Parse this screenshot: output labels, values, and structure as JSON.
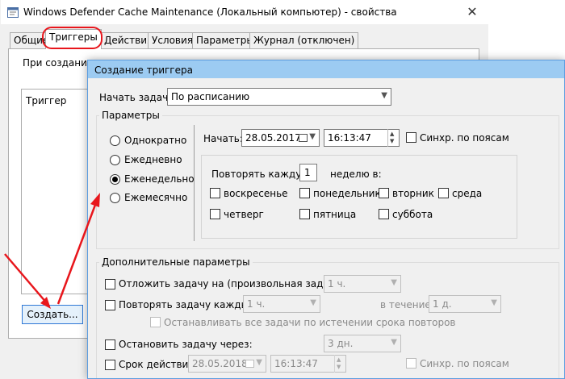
{
  "back_window": {
    "title": "Windows Defender Cache Maintenance (Локальный компьютер) - свойства",
    "close_glyph": "✕",
    "tabs": [
      "Общие",
      "Триггеры",
      "Действия",
      "Условия",
      "Параметры",
      "Журнал (отключен)"
    ],
    "active_tab_index": 1,
    "create_hint": "При создании за",
    "trigger_column": "Триггер",
    "create_button": "Создать..."
  },
  "dialog": {
    "title": "Создание триггера",
    "start_task_label": "Начать задачу:",
    "start_task_value": "По расписанию",
    "params_group": "Параметры",
    "schedule_options": [
      "Однократно",
      "Ежедневно",
      "Еженедельно",
      "Ежемесячно"
    ],
    "selected_schedule_index": 2,
    "start_label": "Начать:",
    "start_date": "28.05.2017",
    "start_time": "16:13:47",
    "sync_zones_label": "Синхр. по поясам",
    "repeat_every_label": "Повторять каждую",
    "repeat_every_value": "1",
    "weeks_label": "неделю в:",
    "days": [
      "воскресенье",
      "понедельник",
      "вторник",
      "среда",
      "четверг",
      "пятница",
      "суббота"
    ],
    "advanced_group": "Дополнительные параметры",
    "delay_label": "Отложить задачу на (произвольная задержка):",
    "delay_value": "1 ч.",
    "repeat_task_label": "Повторять задачу каждые:",
    "repeat_task_value": "1 ч.",
    "duration_label": "в течение:",
    "duration_value": "1 д.",
    "stop_all_label": "Останавливать все задачи по истечении срока повторов",
    "stop_after_label": "Остановить задачу через:",
    "stop_after_value": "3 дн.",
    "expire_label": "Срок действия:",
    "expire_date": "28.05.2018",
    "expire_time": "16:13:47",
    "expire_sync_label": "Синхр. по поясам"
  },
  "colors": {
    "annotation": "#e8161c",
    "dialog_title_bar": "#9ccbf2",
    "window_body": "#f0f0f0"
  }
}
